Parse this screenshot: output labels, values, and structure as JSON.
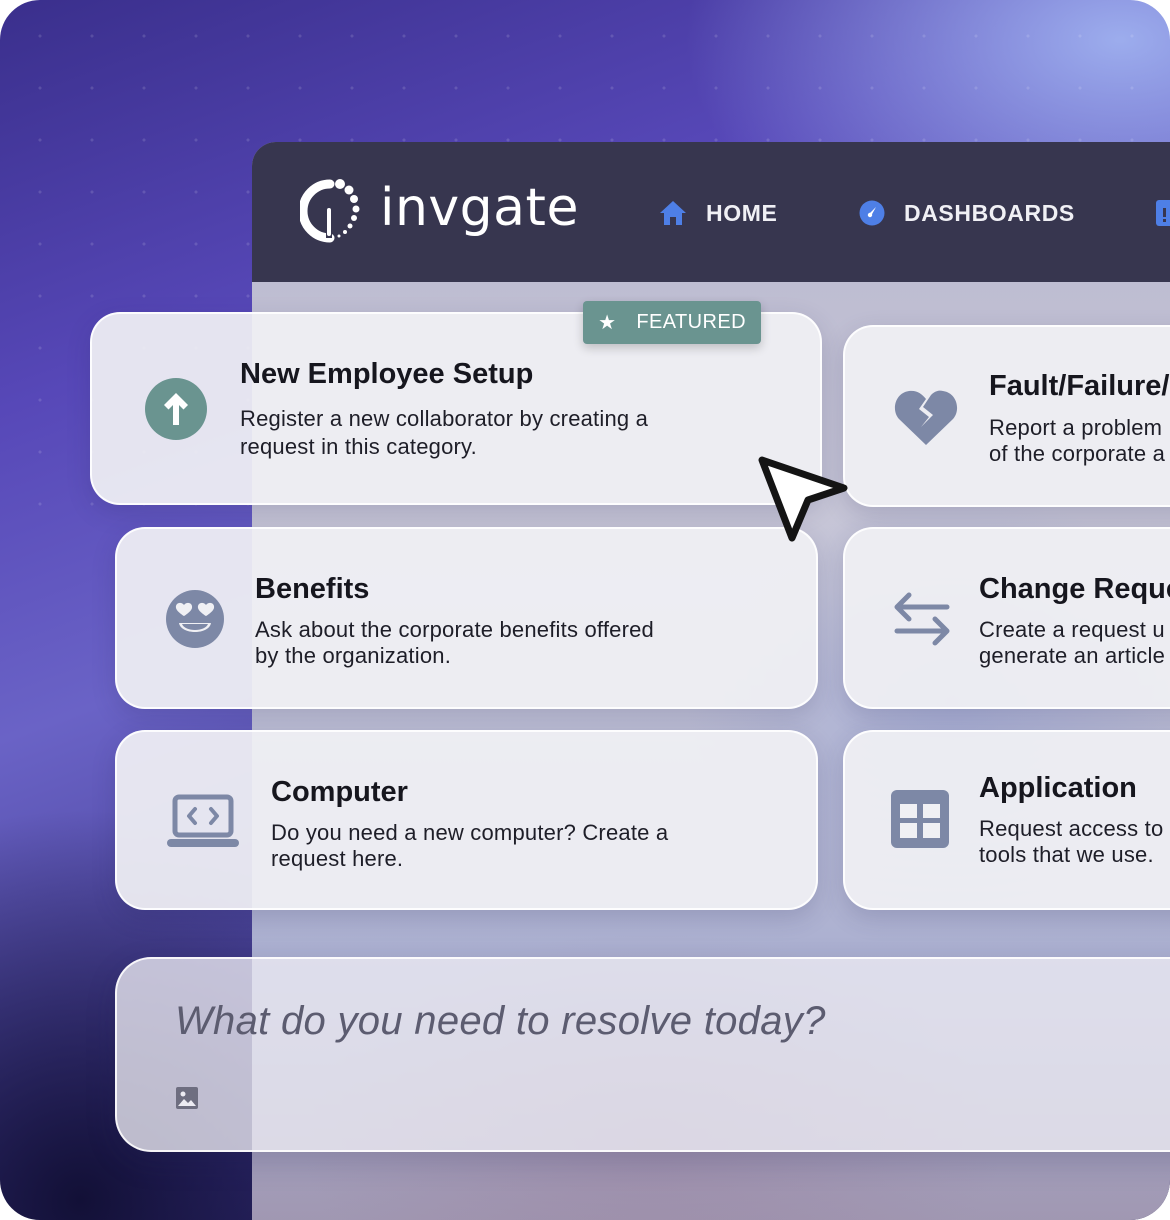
{
  "brand": {
    "name": "invgate"
  },
  "nav": {
    "items": [
      {
        "label": "HOME",
        "icon": "home-icon"
      },
      {
        "label": "DASHBOARDS",
        "icon": "dashboard-gauge-icon"
      }
    ]
  },
  "featured_badge": {
    "label": "FEATURED",
    "icon": "star-icon"
  },
  "categories": [
    {
      "title": "New Employee Setup",
      "description_1": "Register a new collaborator by creating a",
      "description_2": "request in this category.",
      "icon": "arrow-up-circle-icon"
    },
    {
      "title": "Fault/Failure/",
      "description_1": "Report a problem",
      "description_2": "of the corporate a",
      "icon": "broken-heart-icon"
    },
    {
      "title": "Benefits",
      "description_1": "Ask about the corporate benefits offered",
      "description_2": "by the organization.",
      "icon": "heart-eyes-emoji-icon"
    },
    {
      "title": "Change Reque",
      "description_1": "Create a request u",
      "description_2": "generate an article",
      "icon": "swap-arrows-icon"
    },
    {
      "title": "Computer",
      "description_1": "Do you need a new computer? Create a",
      "description_2": "request here.",
      "icon": "laptop-code-icon"
    },
    {
      "title": "Application",
      "description_1": "Request access to",
      "description_2": "tools that we use.",
      "icon": "grid-app-icon"
    }
  ],
  "search": {
    "placeholder": "What do you need to resolve today?",
    "icon": "image-attach-icon"
  },
  "colors": {
    "topbar": "#37364f",
    "accent_teal": "#6a9490",
    "icon_slate": "#7d88a6",
    "nav_blue": "#4e7fe6"
  }
}
